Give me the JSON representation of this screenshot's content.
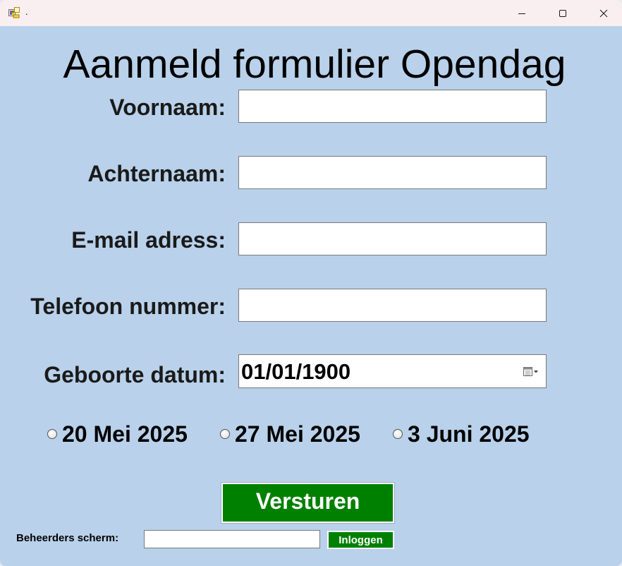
{
  "window": {
    "title": ".",
    "icon": "windows-forms-app-icon",
    "controls": [
      "minimize-icon",
      "maximize-icon",
      "close-icon"
    ]
  },
  "form": {
    "title": "Aanmeld formulier Opendag",
    "fields": {
      "first_name": {
        "label": "Voornaam:",
        "value": ""
      },
      "last_name": {
        "label": "Achternaam:",
        "value": ""
      },
      "email": {
        "label": "E-mail adress:",
        "value": ""
      },
      "phone": {
        "label": "Telefoon nummer:",
        "value": ""
      },
      "birth_date": {
        "label": "Geboorte datum:",
        "value": "01/01/1900",
        "icon": "calendar-dropdown-icon"
      }
    },
    "dates": [
      {
        "label": "20 Mei 2025",
        "selected": false
      },
      {
        "label": "27 Mei 2025",
        "selected": false
      },
      {
        "label": "3 Juni 2025",
        "selected": false
      }
    ],
    "submit_label": "Versturen"
  },
  "admin": {
    "label": "Beheerders scherm:",
    "password_value": "",
    "login_label": "Inloggen"
  },
  "colors": {
    "window_background": "#b9d1ea",
    "titlebar_background": "#f9eef0",
    "button_green": "#008000",
    "button_text": "#ffffff"
  }
}
